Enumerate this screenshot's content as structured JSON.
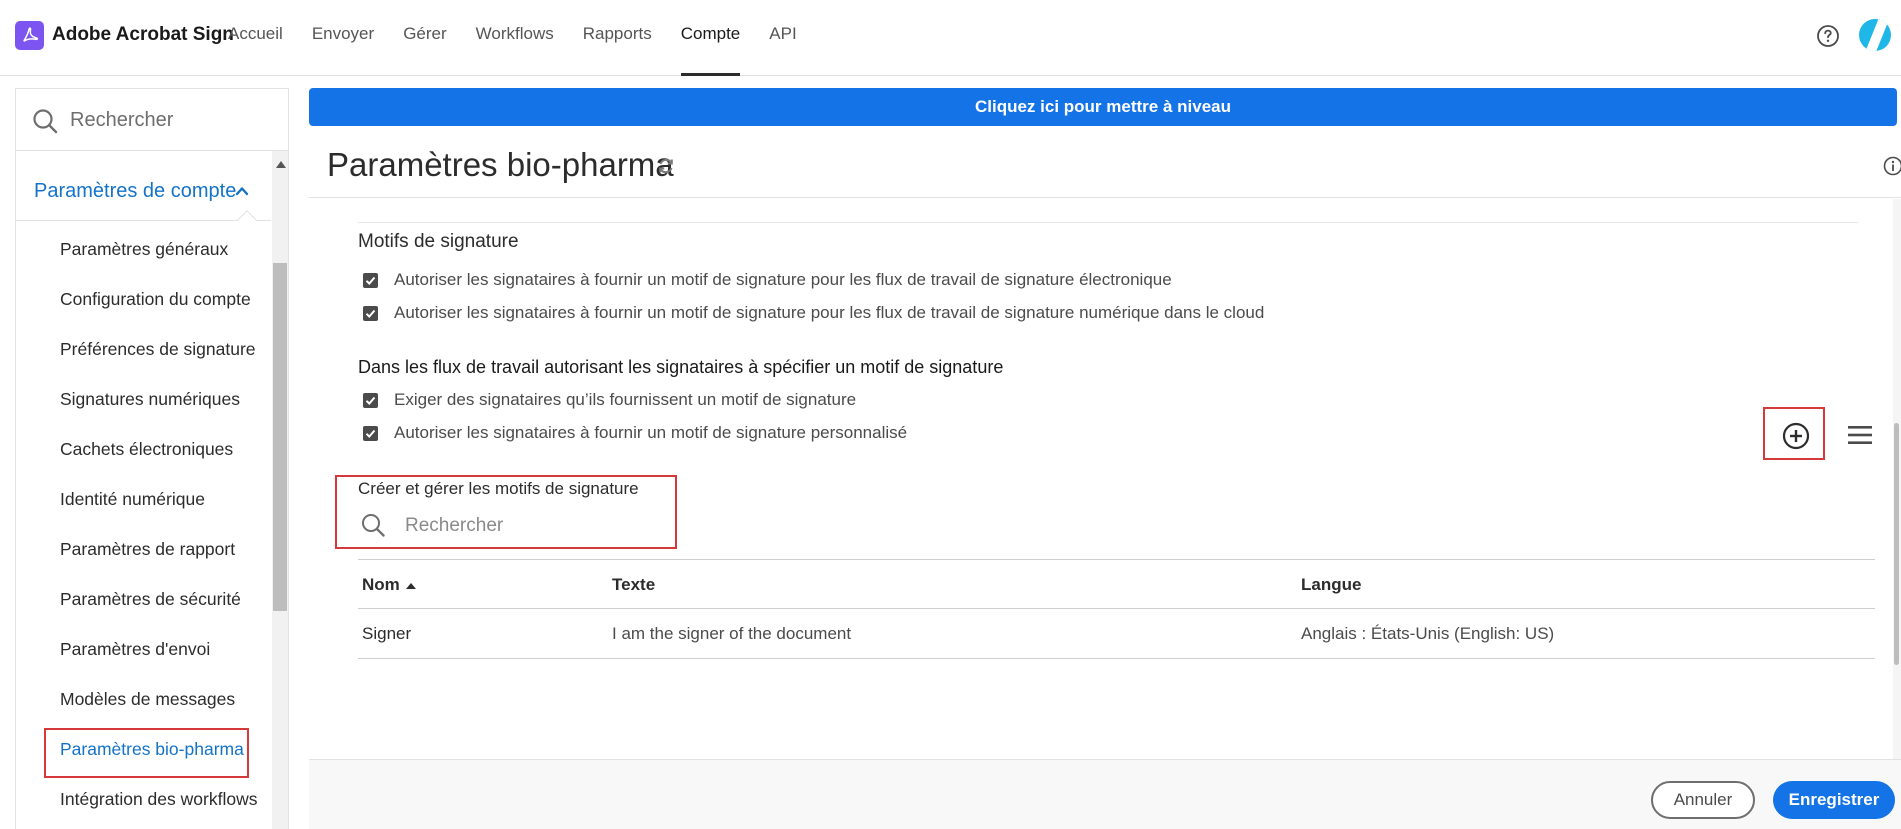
{
  "app": {
    "brand": "Adobe Acrobat Sign",
    "logo_icon": "acrobat-logo-icon",
    "brand_color": "#7c55f0",
    "accent_color": "#1473e6",
    "highlight_color": "#d43a3a"
  },
  "nav": {
    "links": [
      "Accueil",
      "Envoyer",
      "Gérer",
      "Workflows",
      "Rapports",
      "Compte",
      "API"
    ],
    "active": "Compte",
    "help_icon": "help-icon",
    "avatar_icon": "avatar"
  },
  "sidebar": {
    "search_placeholder": "Rechercher",
    "section_label": "Paramètres de compte",
    "items": [
      {
        "label": "Paramètres généraux"
      },
      {
        "label": "Configuration du compte"
      },
      {
        "label": "Préférences de signature"
      },
      {
        "label": "Signatures numériques"
      },
      {
        "label": "Cachets électroniques"
      },
      {
        "label": "Identité numérique"
      },
      {
        "label": "Paramètres de rapport"
      },
      {
        "label": "Paramètres de sécurité"
      },
      {
        "label": "Paramètres d'envoi"
      },
      {
        "label": "Modèles de messages"
      },
      {
        "label": "Paramètres bio-pharma"
      },
      {
        "label": "Intégration des workflows"
      }
    ],
    "active_index": 10
  },
  "banner": {
    "label": "Cliquez ici pour mettre à niveau"
  },
  "page": {
    "title": "Paramètres bio-pharma",
    "refresh_icon": "refresh-icon",
    "info_icon": "info-icon"
  },
  "reasons": {
    "heading": "Motifs de signature",
    "options": [
      {
        "label": "Autoriser les signataires à fournir un motif de signature pour les flux de travail de signature électronique",
        "checked": true
      },
      {
        "label": "Autoriser les signataires à fournir un motif de signature pour les flux de travail de signature numérique dans le cloud",
        "checked": true
      }
    ],
    "sub_heading": "Dans les flux de travail autorisant les signataires à spécifier un motif de signature",
    "sub_options": [
      {
        "label": "Exiger des signataires qu’ils fournissent un motif de signature",
        "checked": true
      },
      {
        "label": "Autoriser les signataires à fournir un motif de signature personnalisé",
        "checked": true
      }
    ]
  },
  "manage": {
    "title": "Créer et gérer les motifs de signature",
    "search_placeholder": "Rechercher",
    "add_icon": "add-circle-icon",
    "menu_icon": "hamburger-menu-icon"
  },
  "table": {
    "columns": [
      "Nom",
      "Texte",
      "Langue"
    ],
    "sort_column": "Nom",
    "sort_direction": "ascending",
    "rows": [
      {
        "name": "Signer",
        "text": "I am the signer of the document",
        "language": "Anglais : États-Unis (English: US)"
      }
    ]
  },
  "footer": {
    "cancel_label": "Annuler",
    "save_label": "Enregistrer"
  }
}
